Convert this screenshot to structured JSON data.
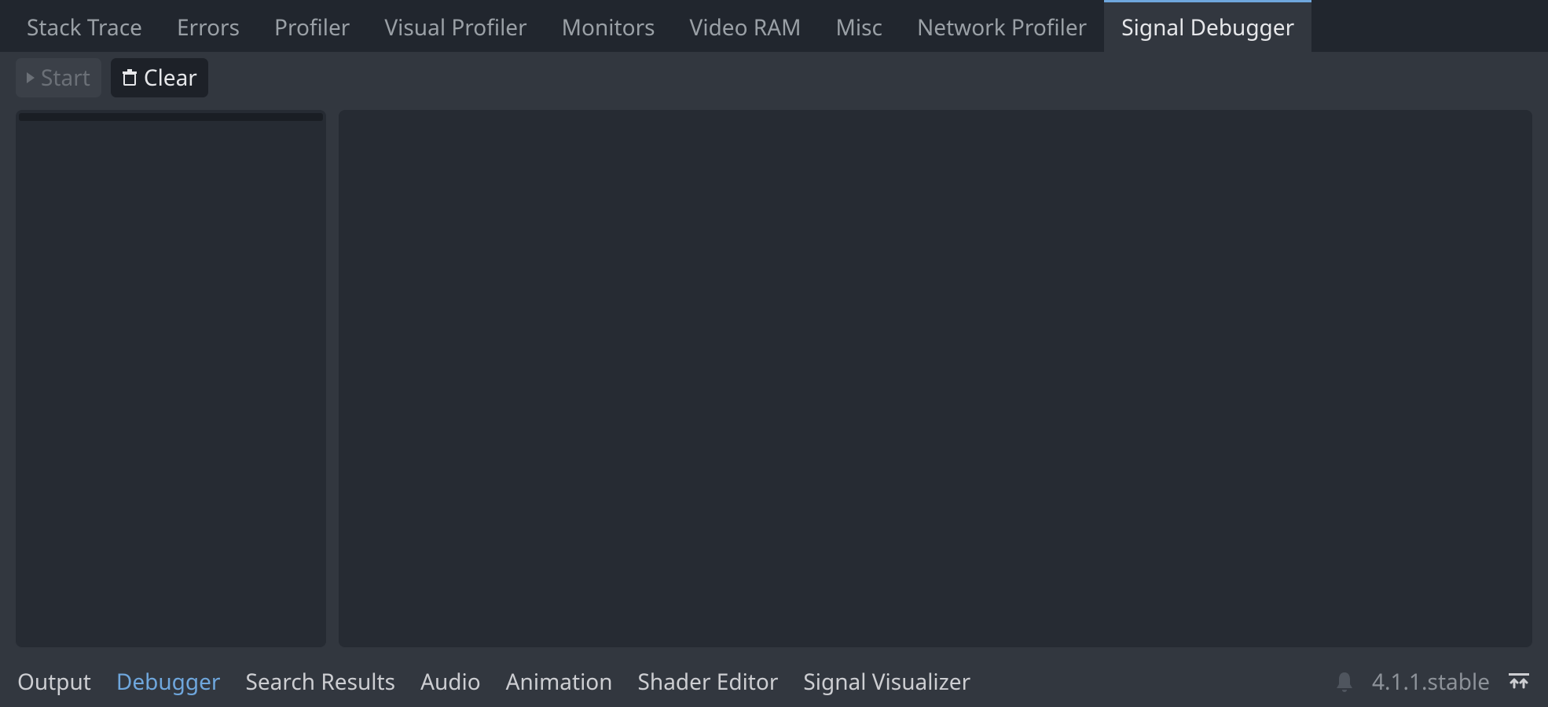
{
  "top_tabs": [
    {
      "label": "Stack Trace",
      "active": false
    },
    {
      "label": "Errors",
      "active": false
    },
    {
      "label": "Profiler",
      "active": false
    },
    {
      "label": "Visual Profiler",
      "active": false
    },
    {
      "label": "Monitors",
      "active": false
    },
    {
      "label": "Video RAM",
      "active": false
    },
    {
      "label": "Misc",
      "active": false
    },
    {
      "label": "Network Profiler",
      "active": false
    },
    {
      "label": "Signal Debugger",
      "active": true
    }
  ],
  "toolbar": {
    "start_label": "Start",
    "clear_label": "Clear"
  },
  "bottom_tabs": [
    {
      "label": "Output",
      "active": false
    },
    {
      "label": "Debugger",
      "active": true
    },
    {
      "label": "Search Results",
      "active": false
    },
    {
      "label": "Audio",
      "active": false
    },
    {
      "label": "Animation",
      "active": false
    },
    {
      "label": "Shader Editor",
      "active": false
    },
    {
      "label": "Signal Visualizer",
      "active": false
    }
  ],
  "status": {
    "version": "4.1.1.stable"
  }
}
